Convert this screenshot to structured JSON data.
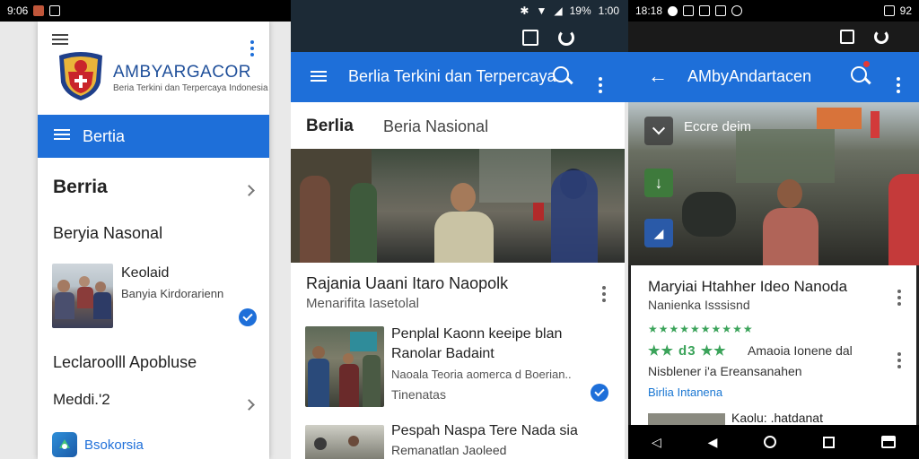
{
  "status_left": {
    "time": "9:06"
  },
  "status_mid": {
    "battery": "19%",
    "time": "1:00"
  },
  "status_right": {
    "time": "18:18",
    "num": "92"
  },
  "panel1": {
    "brand": "AMBYARGACOR",
    "tagline": "Beria Terkini dan Terpercaya Indonesia",
    "menu_label": "Bertia",
    "section_title": "Berria",
    "sub_title": "Beryia Nasonal",
    "item1_title": "Keolaid",
    "item1_sub": "Banyia Kirdorarienn",
    "item2_title": "Leclaroolll Apobluse",
    "item3_title": "Meddi.'2",
    "footer_label": "Bsokorsia"
  },
  "panel2": {
    "title": "Berlia Terkini dan Terpercaya",
    "tab_active": "Berlia",
    "tab_other": "Beria Nasional",
    "headline": "Rajania Uaani Itaro Naopolk",
    "headline_sub": "Menarifita Iasetolal",
    "item1_title_line1": "Penplal Kaonn keeipe blan",
    "item1_title_line2": "Ranolar Badaint",
    "item1_sub": "Naoala Teoria aomerca d Boerian..",
    "item1_tag": "Tinenatas",
    "item2_title": "Pespah Naspa Tere Nada sia",
    "item2_sub": "Remanatlan Jaoleed"
  },
  "panel3": {
    "title": "AMbyAndartacen",
    "overlay_label": "Eccre deim",
    "headline": "Maryiai Htahher Ideo Nanoda",
    "headline_sub": "Nanienka Isssisnd",
    "stars_row": "★★★★★★★★★★",
    "rating_stars": "★★ d3 ★★",
    "rating_text": "Amaoia Ionene dal",
    "rating_sub": "Nisblener i'a Ereansanahen",
    "link": "Birlia Intanena",
    "bottom_peek": "Kaolu: .hatdanat"
  },
  "colors": {
    "accent": "#1e6fd9",
    "accent_light": "#1976d2",
    "star": "#3ba35a"
  }
}
